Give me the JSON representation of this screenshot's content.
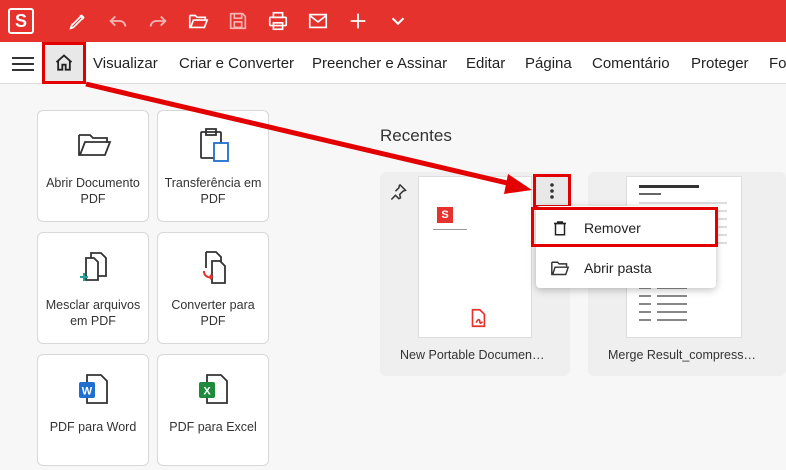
{
  "app": {
    "logo_letter": "S"
  },
  "toolbar": {
    "icons": [
      "pen-icon",
      "undo-icon",
      "redo-icon",
      "open-folder-icon",
      "save-icon",
      "print-icon",
      "mail-icon",
      "plus-icon",
      "chevron-down-icon"
    ]
  },
  "menu": {
    "items": [
      "Visualizar",
      "Criar e Converter",
      "Preencher e Assinar",
      "Editar",
      "Página",
      "Comentário",
      "Proteger",
      "Fo"
    ]
  },
  "tiles": [
    {
      "label": "Abrir Documento PDF",
      "icon": "folder-icon"
    },
    {
      "label": "Transferência em PDF",
      "icon": "clipboard-icon"
    },
    {
      "label": "Mesclar arquivos em PDF",
      "icon": "merge-files-icon"
    },
    {
      "label": "Converter para PDF",
      "icon": "convert-icon"
    },
    {
      "label": "PDF para Word",
      "icon": "word-icon",
      "badge": "W",
      "badge_color": "#1e6fd0"
    },
    {
      "label": "PDF para Excel",
      "icon": "excel-icon",
      "badge": "X",
      "badge_color": "#1e8a3c"
    }
  ],
  "recent": {
    "heading": "Recentes",
    "files": [
      {
        "name": "New Portable Documen…",
        "thumb_logo": "S"
      },
      {
        "name": "Merge Result_compress…"
      }
    ]
  },
  "context_menu": {
    "items": [
      {
        "label": "Remover",
        "icon": "trash-icon"
      },
      {
        "label": "Abrir pasta",
        "icon": "folder-open-icon"
      }
    ]
  },
  "colors": {
    "brand": "#e5322d",
    "highlight": "#e30000"
  }
}
